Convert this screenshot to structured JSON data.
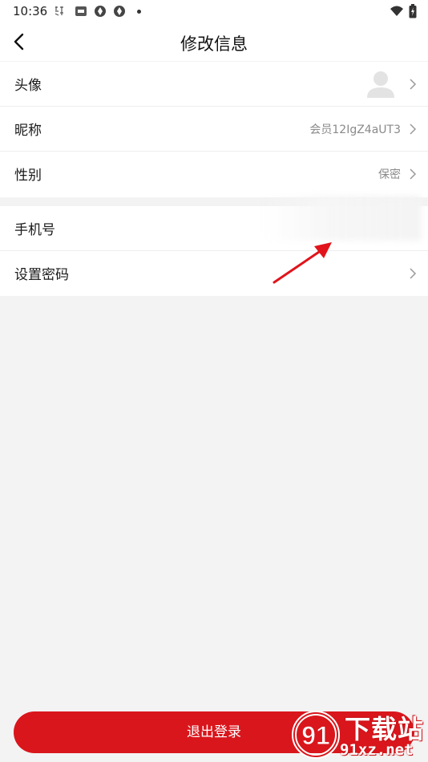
{
  "status_bar": {
    "time": "10:36"
  },
  "header": {
    "title": "修改信息"
  },
  "rows": [
    {
      "label": "头像"
    },
    {
      "label": "昵称",
      "value": "会员12IgZ4aUT3"
    },
    {
      "label": "性别",
      "value": "保密"
    },
    {
      "label": "手机号"
    },
    {
      "label": "设置密码"
    }
  ],
  "logout": {
    "label": "退出登录"
  },
  "watermark": {
    "title": "下载站",
    "url": "91xz.net",
    "logo_text": "91"
  },
  "colors": {
    "accent": "#d9161c",
    "background": "#f3f3f3",
    "arrow": "#e0141a"
  }
}
